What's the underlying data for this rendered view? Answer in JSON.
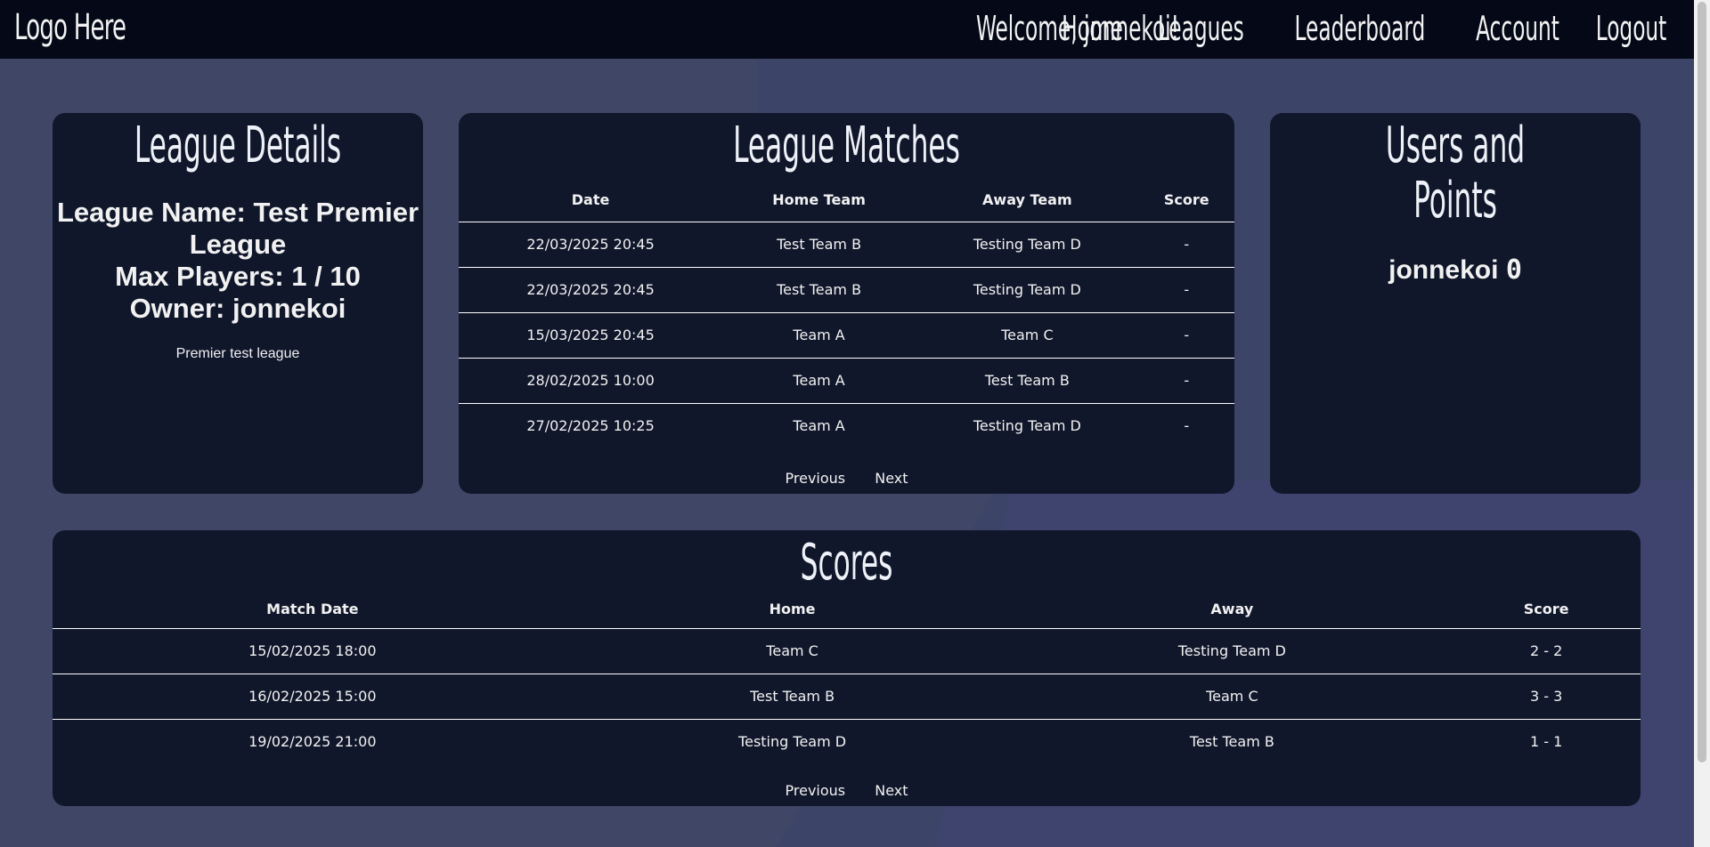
{
  "header": {
    "logo": "Logo Here",
    "welcome": "Welcome, jonnekoi!",
    "nav": [
      "Home",
      "Leagues",
      "Leaderboard",
      "Account",
      "Logout"
    ]
  },
  "details": {
    "title": "League Details",
    "name_line": "League Name: Test Premier League",
    "max_players_line": "Max Players: 1 / 10",
    "owner_line": "Owner: jonnekoi",
    "description": "Premier test league"
  },
  "matches": {
    "title": "League Matches",
    "columns": [
      "Date",
      "Home Team",
      "Away Team",
      "Score"
    ],
    "rows": [
      [
        "22/03/2025 20:45",
        "Test Team B",
        "Testing Team D",
        "-"
      ],
      [
        "22/03/2025 20:45",
        "Test Team B",
        "Testing Team D",
        "-"
      ],
      [
        "15/03/2025 20:45",
        "Team A",
        "Team C",
        "-"
      ],
      [
        "28/02/2025 10:00",
        "Team A",
        "Test Team B",
        "-"
      ],
      [
        "27/02/2025 10:25",
        "Team A",
        "Testing Team D",
        "-"
      ]
    ],
    "prev": "Previous",
    "next": "Next"
  },
  "users": {
    "title": "Users and Points",
    "entries": [
      {
        "name": "jonnekoi",
        "points": "0"
      }
    ]
  },
  "scores": {
    "title": "Scores",
    "columns": [
      "Match Date",
      "Home",
      "Away",
      "Score"
    ],
    "rows": [
      [
        "15/02/2025 18:00",
        "Team C",
        "Testing Team D",
        "2 - 2"
      ],
      [
        "16/02/2025 15:00",
        "Test Team B",
        "Team C",
        "3 - 3"
      ],
      [
        "19/02/2025 21:00",
        "Testing Team D",
        "Test Team B",
        "1 - 1"
      ]
    ],
    "prev": "Previous",
    "next": "Next"
  }
}
